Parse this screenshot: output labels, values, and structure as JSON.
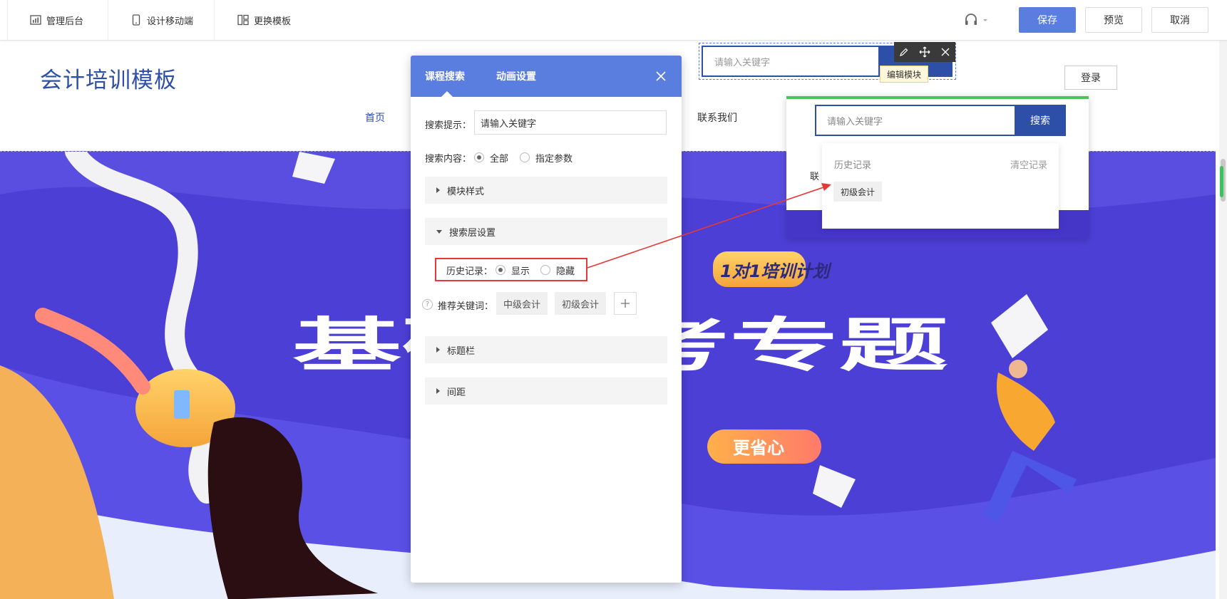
{
  "toolbar": {
    "admin_label": "管理后台",
    "mobile_label": "设计移动端",
    "template_label": "更换模板",
    "save_label": "保存",
    "preview_label": "预览",
    "cancel_label": "取消"
  },
  "site": {
    "title": "会计培训模板",
    "nav_home": "首页",
    "nav_contact": "联系我们",
    "login": "登录",
    "search_placeholder": "请输入关键字",
    "banner": {
      "tag": "1对1培训计划",
      "headline": "基础备考专题",
      "pill": "更省心"
    }
  },
  "module_toolbar": {
    "tooltip": "编辑模块"
  },
  "preview_card": {
    "placeholder": "请输入关键字",
    "button": "搜索",
    "partial_text": "联",
    "history_label": "历史记录",
    "clear_label": "清空记录",
    "history_items": [
      "初级会计"
    ]
  },
  "panel": {
    "tabs": [
      "课程搜索",
      "动画设置"
    ],
    "hint_label": "搜索提示：",
    "hint_value": "请输入关键字",
    "content_label": "搜索内容：",
    "content_options": [
      "全部",
      "指定参数"
    ],
    "sections": {
      "module_style": "模块样式",
      "search_layer": "搜索层设置",
      "title_bar": "标题栏",
      "spacing": "间距"
    },
    "history_label": "历史记录：",
    "history_options": [
      "显示",
      "隐藏"
    ],
    "keywords_label": "推荐关键词：",
    "keywords": [
      "中级会计",
      "初级会计"
    ]
  },
  "colors": {
    "primary": "#5a7de0",
    "brand_dark": "#2d4fa8",
    "banner": "#4c3fd6",
    "highlight": "#e53935",
    "success": "#4cc45c"
  }
}
